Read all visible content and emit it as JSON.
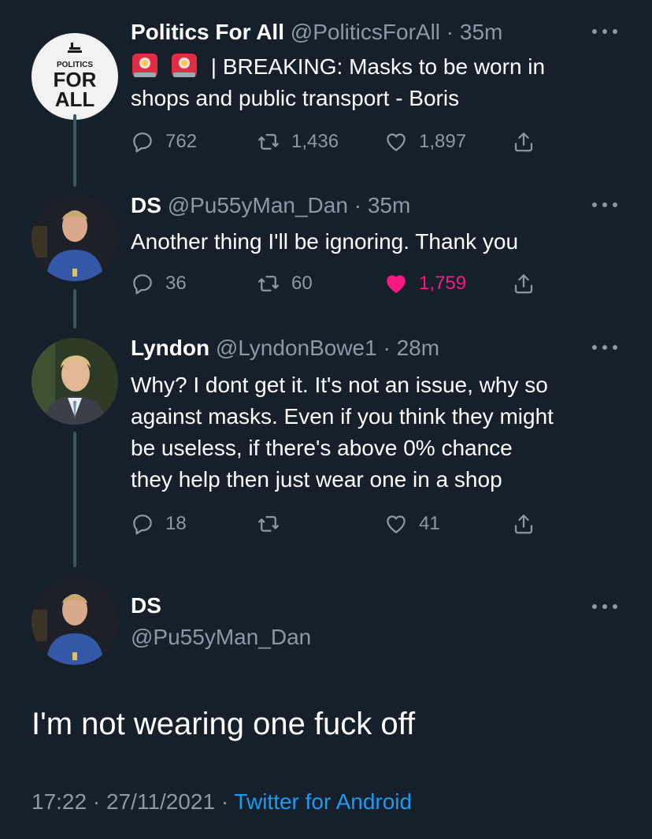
{
  "tweets": [
    {
      "name": "Politics For All",
      "handle": "@PoliticsForAll",
      "time": "35m",
      "text": "| BREAKING: Masks to be worn in",
      "text2": "shops and public transport - Boris",
      "replies": "762",
      "retweets": "1,436",
      "likes": "1,897",
      "avatar_text": [
        "POLITICS",
        "FOR",
        "ALL"
      ]
    },
    {
      "name": "DS",
      "handle": "@Pu55yMan_Dan",
      "time": "35m",
      "text": "Another thing I'll be ignoring. Thank you",
      "replies": "36",
      "retweets": "60",
      "likes": "1,759"
    },
    {
      "name": "Lyndon",
      "handle": "@LyndonBowe1",
      "time": "28m",
      "lines": [
        "Why? I dont get it. It's not an issue, why so",
        "against masks. Even if you think they might",
        "be useless, if there's above 0% chance",
        "they help then just wear one in a shop"
      ],
      "replies": "18",
      "retweets": "",
      "likes": "41"
    }
  ],
  "main": {
    "name": "DS",
    "handle": "@Pu55yMan_Dan",
    "text": "I'm not wearing one fuck off",
    "time": "17:22",
    "date": "27/11/2021",
    "source": "Twitter for Android"
  },
  "colors": {
    "background": "#15202b",
    "muted": "#8b98a5",
    "like": "#f91880",
    "link": "#1d9bf0"
  }
}
